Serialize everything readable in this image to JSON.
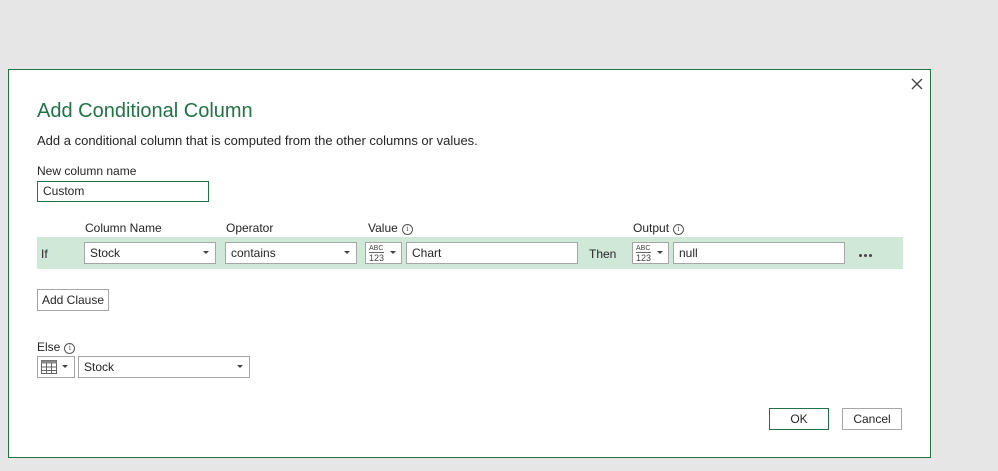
{
  "dialog": {
    "title": "Add Conditional Column",
    "subtitle": "Add a conditional column that is computed from the other columns or values.",
    "new_column_label": "New column name",
    "new_column_value": "Custom"
  },
  "headers": {
    "column_name": "Column Name",
    "operator": "Operator",
    "value": "Value",
    "output": "Output"
  },
  "clause": {
    "if_label": "If",
    "column_name": "Stock",
    "operator": "contains",
    "value_type_abc": "ABC",
    "value_type_num": "123",
    "value": "Chart",
    "then_label": "Then",
    "output_type_abc": "ABC",
    "output_type_num": "123",
    "output": "null"
  },
  "add_clause_label": "Add Clause",
  "else": {
    "label": "Else",
    "value": "Stock"
  },
  "buttons": {
    "ok": "OK",
    "cancel": "Cancel"
  },
  "info_glyph": "i",
  "colors": {
    "accent": "#217346",
    "row_highlight": "#cfe8d7",
    "background": "#e6e6e6"
  }
}
